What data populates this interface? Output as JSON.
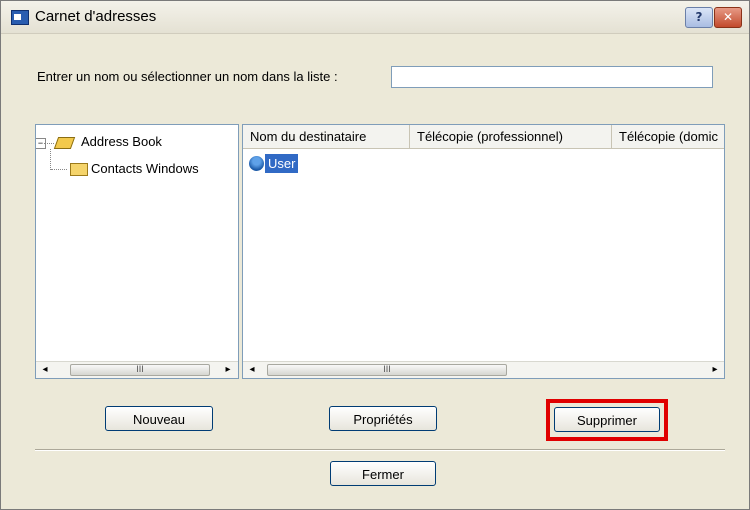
{
  "window": {
    "title": "Carnet d'adresses",
    "help_label": "?",
    "close_label": "✕"
  },
  "search": {
    "prompt": "Entrer un nom ou sélectionner un nom dans la liste :",
    "value": ""
  },
  "tree": {
    "expander": "−",
    "root": {
      "label": "Address Book",
      "icon": "book-icon"
    },
    "child": {
      "label": "Contacts Windows",
      "icon": "folder-icon"
    }
  },
  "list": {
    "columns": [
      "Nom du destinataire",
      "Télécopie (professionnel)",
      "Télécopie (domic"
    ],
    "rows": [
      {
        "name": "User",
        "icon": "contact-icon",
        "selected": true
      }
    ]
  },
  "scrollbar": {
    "left_arrow": "◂",
    "right_arrow": "▸",
    "grip": "III"
  },
  "buttons": {
    "new": "Nouveau",
    "properties": "Propriétés",
    "delete": "Supprimer",
    "close": "Fermer"
  },
  "highlight_color": "#e00000"
}
